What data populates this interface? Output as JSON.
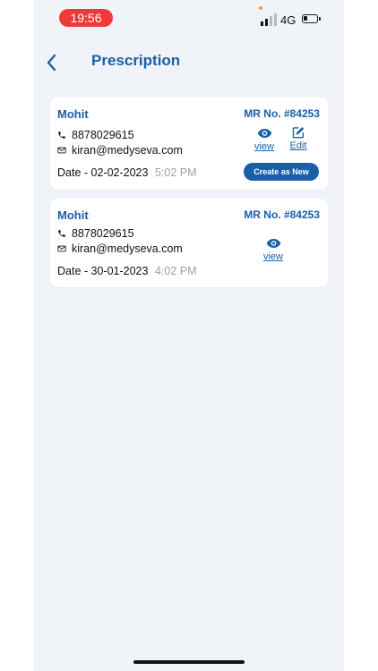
{
  "status_bar": {
    "time": "19:56",
    "network": "4G"
  },
  "header": {
    "title": "Prescription"
  },
  "prescriptions": [
    {
      "name": "Mohit",
      "mr_no": "MR No. #84253",
      "phone": "8878029615",
      "email": "kiran@medyseva.com",
      "date": "Date - 02-02-2023",
      "time": "5:02 PM",
      "view_label": "view",
      "edit_label": "Edit",
      "create_label": "Create as New"
    },
    {
      "name": "Mohit",
      "mr_no": "MR No. #84253",
      "phone": "8878029615",
      "email": "kiran@medyseva.com",
      "date": "Date - 30-01-2023",
      "time": "4:02 PM",
      "view_label": "view"
    }
  ],
  "colors": {
    "accent": "#1a5fa8",
    "background": "#f0f3f8",
    "time_pill": "#ee3a38",
    "muted_text": "#9aa0a6"
  },
  "icons": {
    "back": "chevron-left-icon",
    "phone": "phone-icon",
    "email": "mail-icon",
    "view": "eye-icon",
    "edit": "edit-icon"
  }
}
